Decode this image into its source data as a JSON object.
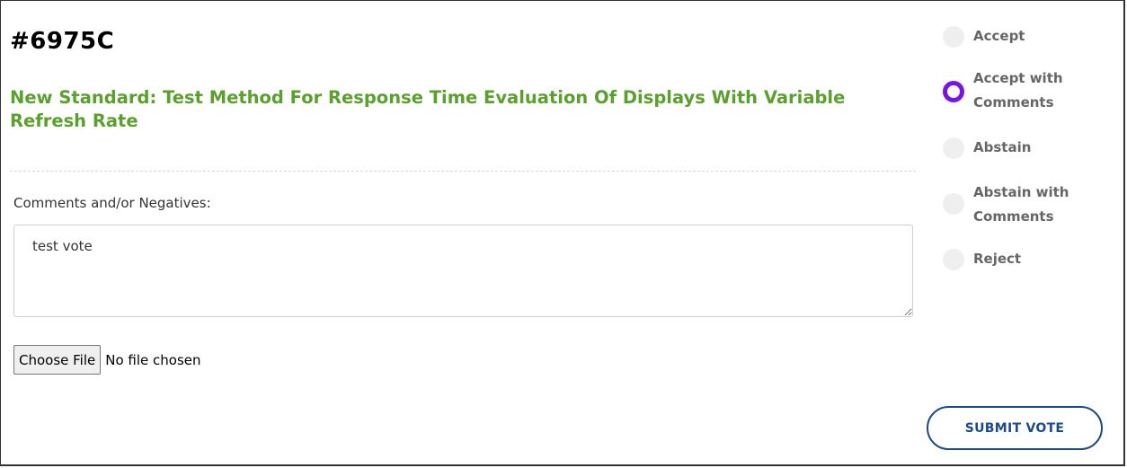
{
  "ballot": {
    "id": "#6975C",
    "title": "New Standard: Test Method For Response Time Evaluation Of Displays With Variable Refresh Rate"
  },
  "comments": {
    "label": "Comments and/or Negatives:",
    "value": "test vote"
  },
  "file_upload": {
    "button_label": "Choose File",
    "status": "No file chosen"
  },
  "vote_options": [
    {
      "label": "Accept",
      "selected": false
    },
    {
      "label": "Accept with Comments",
      "selected": true
    },
    {
      "label": "Abstain",
      "selected": false
    },
    {
      "label": "Abstain with Comments",
      "selected": false
    },
    {
      "label": "Reject",
      "selected": false
    }
  ],
  "submit": {
    "label": "SUBMIT VOTE"
  },
  "colors": {
    "title_green": "#5aa02c",
    "radio_selected": "#7a14e3",
    "submit_blue": "#1a4a8a"
  }
}
